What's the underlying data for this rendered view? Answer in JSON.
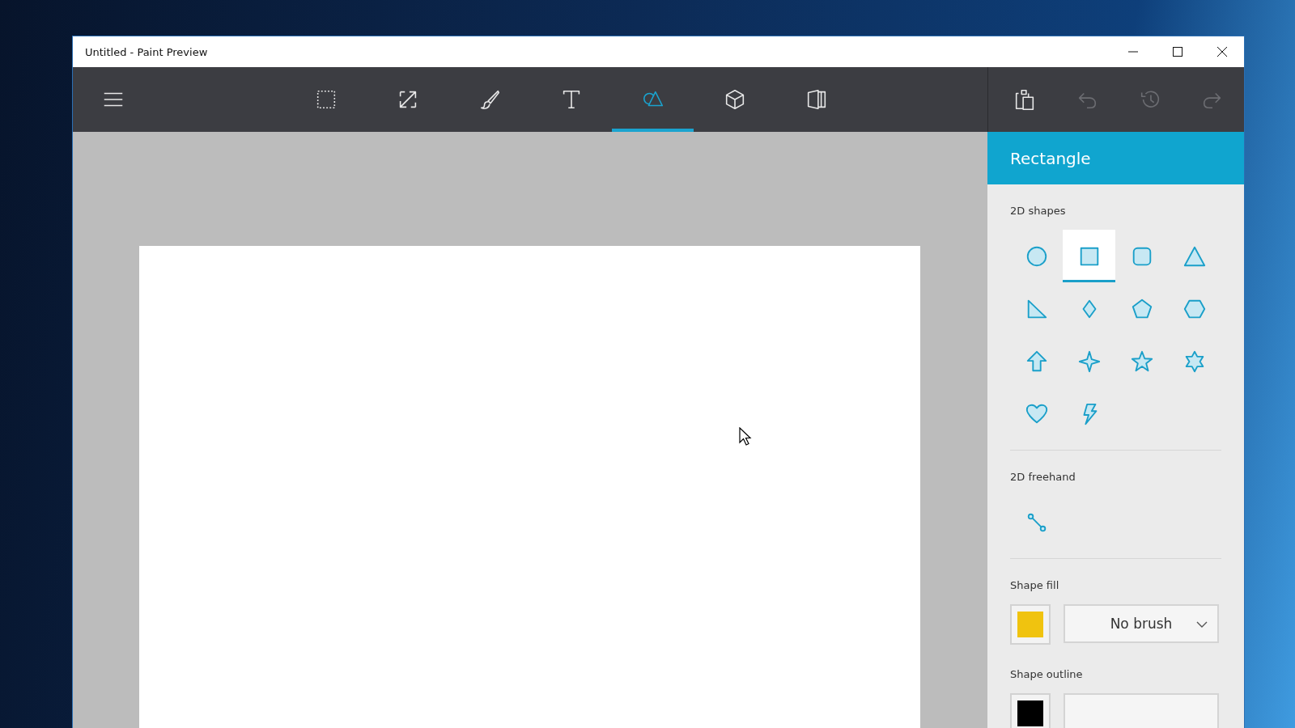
{
  "window": {
    "title": "Untitled - Paint Preview"
  },
  "toolbar": {
    "tools": [
      {
        "kind": "select",
        "selected": false
      },
      {
        "kind": "crop",
        "selected": false
      },
      {
        "kind": "brush",
        "selected": false
      },
      {
        "kind": "text",
        "selected": false
      },
      {
        "kind": "shapes",
        "selected": true
      },
      {
        "kind": "cube",
        "selected": false
      },
      {
        "kind": "stickers",
        "selected": false
      }
    ],
    "actions": [
      {
        "kind": "paste",
        "disabled": false
      },
      {
        "kind": "undo",
        "disabled": true
      },
      {
        "kind": "history",
        "disabled": true
      },
      {
        "kind": "redo",
        "disabled": true
      }
    ]
  },
  "panel": {
    "title": "Rectangle",
    "shapes_section": {
      "label": "2D shapes",
      "shapes": [
        {
          "kind": "circle",
          "selected": false
        },
        {
          "kind": "rectangle",
          "selected": true
        },
        {
          "kind": "rounded",
          "selected": false
        },
        {
          "kind": "triangle",
          "selected": false
        },
        {
          "kind": "right-triangle",
          "selected": false
        },
        {
          "kind": "diamond",
          "selected": false
        },
        {
          "kind": "pentagon",
          "selected": false
        },
        {
          "kind": "hexagon",
          "selected": false
        },
        {
          "kind": "arrow",
          "selected": false
        },
        {
          "kind": "star4",
          "selected": false
        },
        {
          "kind": "star5",
          "selected": false
        },
        {
          "kind": "star6",
          "selected": false
        },
        {
          "kind": "heart",
          "selected": false
        },
        {
          "kind": "lightning",
          "selected": false
        }
      ]
    },
    "freehand_section": {
      "label": "2D freehand",
      "shapes": [
        {
          "kind": "line",
          "selected": false
        }
      ]
    },
    "fill": {
      "label": "Shape fill",
      "color": "#f0c30f",
      "value": "No brush"
    },
    "outline": {
      "label": "Shape outline",
      "color": "#000000"
    }
  }
}
